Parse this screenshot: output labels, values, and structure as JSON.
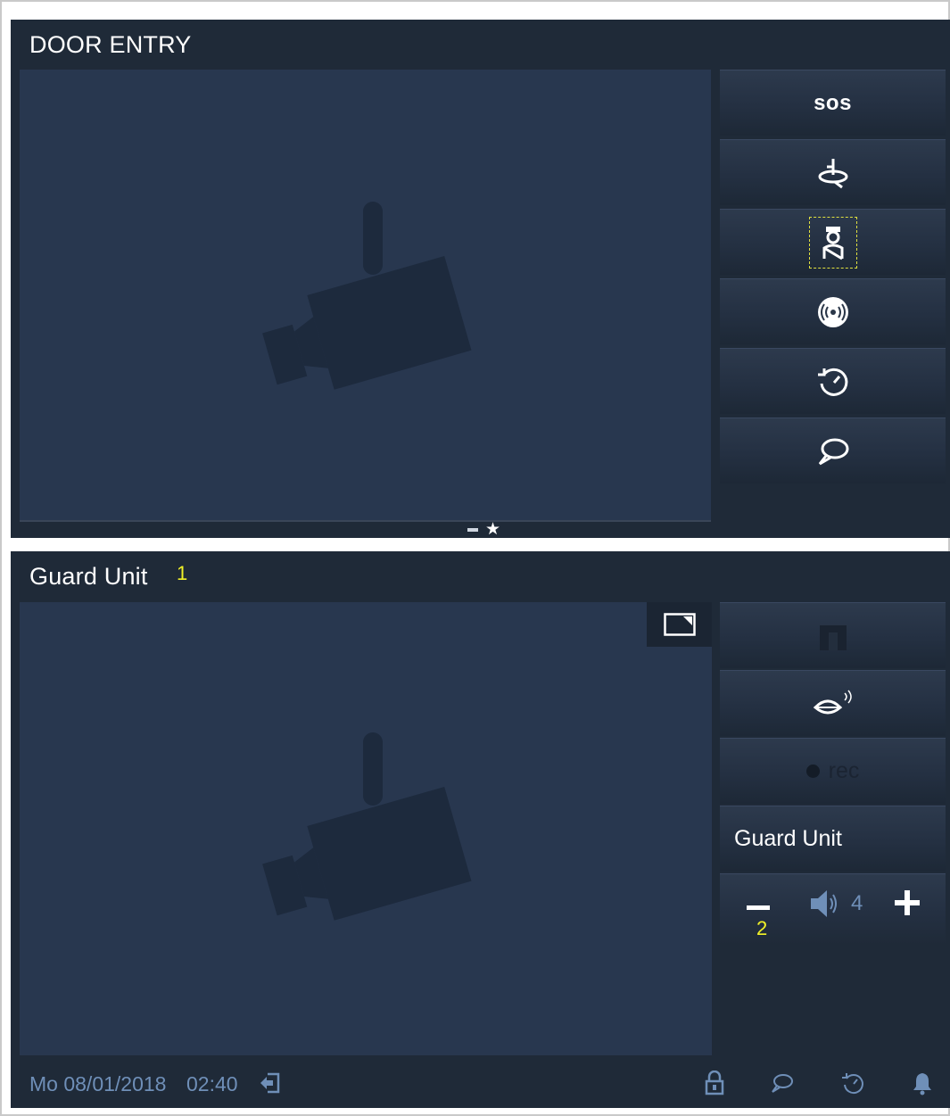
{
  "colors": {
    "panel_bg": "#1f2a38",
    "video_bg": "#28374f",
    "text_white": "#ffffff",
    "status_text": "#6f8fb8",
    "annotation": "#f2f227",
    "focus_border": "#e0e040"
  },
  "door_entry": {
    "title": "DOOR ENTRY",
    "video_placeholder_icon": "camera-placeholder-icon",
    "buttons": [
      {
        "label": "sos",
        "icon": "sos-text"
      },
      {
        "label": "",
        "icon": "surveillance-rotate-icon"
      },
      {
        "label": "",
        "icon": "guard-unit-icon",
        "focused": true
      },
      {
        "label": "",
        "icon": "alarm-signal-icon"
      },
      {
        "label": "",
        "icon": "history-icon"
      },
      {
        "label": "",
        "icon": "message-icon"
      }
    ],
    "pager": {
      "indicators": [
        "page-dash-icon",
        "favorite-star-icon"
      ]
    }
  },
  "guard_unit": {
    "title": "Guard Unit",
    "annotation_1": "1",
    "annotation_2": "2",
    "pip_icon": "picture-in-picture-icon",
    "buttons": [
      {
        "icon": "unlock-door-icon",
        "enabled": false
      },
      {
        "icon": "talk-mouth-icon",
        "enabled": true
      },
      {
        "label": "rec",
        "icon": "record-icon",
        "enabled": false
      }
    ],
    "callee_name": "Guard Unit",
    "volume": {
      "level": "4",
      "minus_icon": "minus-icon",
      "plus_icon": "plus-icon",
      "speaker_icon": "speaker-icon"
    }
  },
  "status_bar": {
    "date": "Mo 08/01/2018",
    "time": "02:40",
    "icons": [
      "exit-home-icon",
      "lock-icon",
      "message-icon",
      "history-icon",
      "bell-icon"
    ]
  }
}
